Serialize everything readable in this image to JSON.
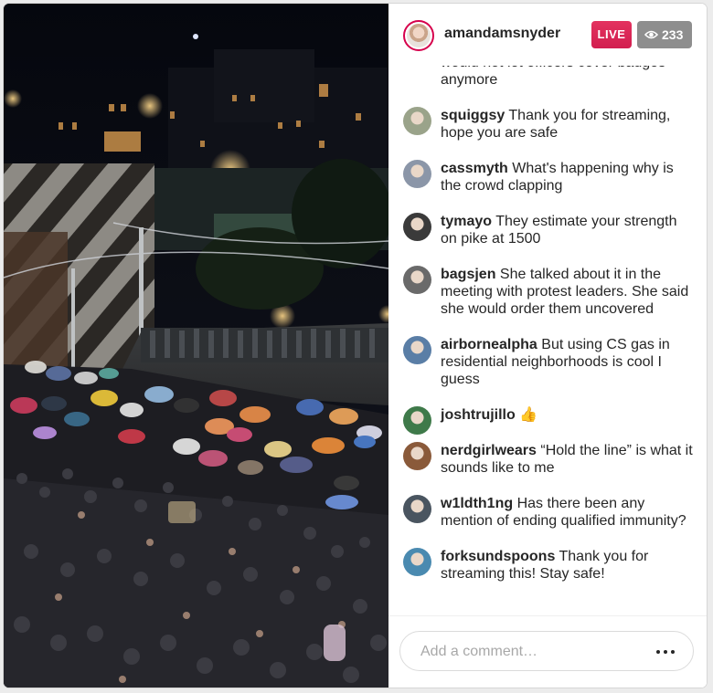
{
  "stream": {
    "host": "amandamsnyder",
    "live_label": "LIVE",
    "viewer_count": "233",
    "viewer_icon": "eye-icon"
  },
  "comments": {
    "partial_text": "problem, but was now educated, and would not let officers cover badges anymore",
    "items": [
      {
        "user": "squiggsy",
        "text": "Thank you for streaming, hope you are safe",
        "avatar_color": "#9aa38a"
      },
      {
        "user": "cassmyth",
        "text": "What's happening why is the crowd clapping",
        "avatar_color": "#8b96a8"
      },
      {
        "user": "tymayo",
        "text": "They estimate your strength on pike at 1500",
        "avatar_color": "#3a3a3a"
      },
      {
        "user": "bagsjen",
        "text": "She talked about it in the meeting with protest leaders. She said she would order them uncovered",
        "avatar_color": "#6a6a6a"
      },
      {
        "user": "airbornealpha",
        "text": "But using CS gas in residential neighborhoods is cool I guess",
        "avatar_color": "#5a7ea6"
      },
      {
        "user": "joshtrujillo",
        "text": "👍",
        "avatar_color": "#3f7a4a"
      },
      {
        "user": "nerdgirlwears",
        "text": "“Hold the line” is what it sounds like to me",
        "avatar_color": "#8a5a3a"
      },
      {
        "user": "w1ldth1ng",
        "text": "Has there been any mention of ending qualified immunity?",
        "avatar_color": "#4a5560"
      },
      {
        "user": "forksundspoons",
        "text": "Thank you for streaming this! Stay safe!",
        "avatar_color": "#4a8ab0"
      }
    ]
  },
  "composer": {
    "placeholder": "Add a comment…",
    "more_icon": "more-options-icon"
  },
  "colors": {
    "live_badge": "#d21e4f",
    "viewer_badge": "#8e8e8e",
    "text": "#262626"
  }
}
